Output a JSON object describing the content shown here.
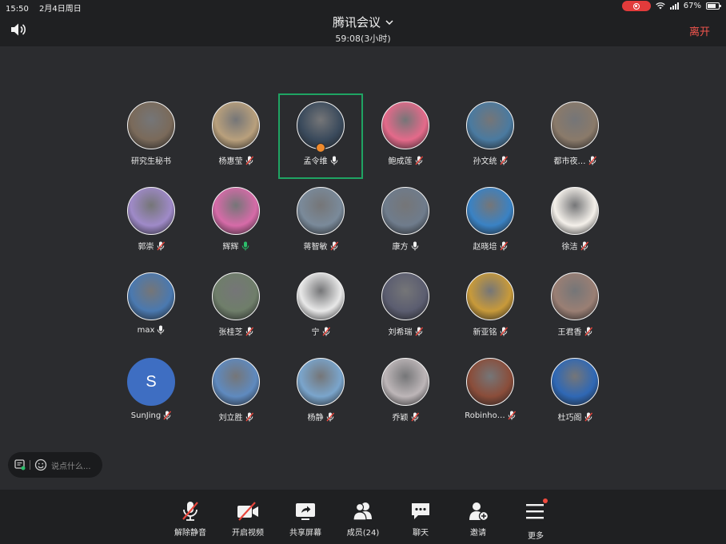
{
  "status_bar": {
    "time": "15:50",
    "date": "2月4日周日",
    "battery": "67%"
  },
  "meeting": {
    "title": "腾讯会议",
    "timer": "59:08(3小时)",
    "leave_label": "离开"
  },
  "participants": [
    {
      "name": "研究生秘书",
      "mic": "none",
      "bg": "#7a6a5a"
    },
    {
      "name": "杨惠莹",
      "mic": "muted",
      "bg": "#b9a07c"
    },
    {
      "name": "孟令维",
      "mic": "on",
      "bg": "#3a4a5c",
      "active": true,
      "host": true
    },
    {
      "name": "鲍成莲",
      "mic": "muted",
      "bg": "#e46a8a"
    },
    {
      "name": "孙文统",
      "mic": "muted",
      "bg": "#4a7aa0"
    },
    {
      "name": "都市夜…",
      "mic": "muted",
      "bg": "#8a7a6a"
    },
    {
      "name": "郭崇",
      "mic": "muted",
      "bg": "#9f8ac8"
    },
    {
      "name": "辉辉",
      "mic": "active",
      "bg": "#d66ba8"
    },
    {
      "name": "蒋智敏",
      "mic": "muted",
      "bg": "#7a8a9a"
    },
    {
      "name": "康方",
      "mic": "on",
      "bg": "#6f7c8c"
    },
    {
      "name": "赵晓培",
      "mic": "muted",
      "bg": "#3a82c4"
    },
    {
      "name": "徐洁",
      "mic": "muted",
      "bg": "#f4f0ea"
    },
    {
      "name": "max",
      "mic": "on",
      "bg": "#4a79b0"
    },
    {
      "name": "张桂芝",
      "mic": "muted",
      "bg": "#6f7e6a"
    },
    {
      "name": "宁",
      "mic": "muted",
      "bg": "#e8e8e8"
    },
    {
      "name": "刘希瑞",
      "mic": "muted",
      "bg": "#5b5d70"
    },
    {
      "name": "新亚铭",
      "mic": "muted",
      "bg": "#c89a3a"
    },
    {
      "name": "王君香",
      "mic": "muted",
      "bg": "#9a7f74"
    },
    {
      "name": "SunJing",
      "mic": "muted",
      "bg": "#3e6ec2",
      "letter": "S"
    },
    {
      "name": "刘立胜",
      "mic": "muted",
      "bg": "#5f8abf"
    },
    {
      "name": "杨静",
      "mic": "muted",
      "bg": "#7aa5cc"
    },
    {
      "name": "乔颖",
      "mic": "muted",
      "bg": "#bdb6b8"
    },
    {
      "name": "Robinho…",
      "mic": "muted",
      "bg": "#8a4d3a"
    },
    {
      "name": "杜巧阁",
      "mic": "muted",
      "bg": "#2f68b5"
    }
  ],
  "chat": {
    "placeholder": "说点什么..."
  },
  "toolbar": {
    "unmute": "解除静音",
    "video": "开启视频",
    "share": "共享屏幕",
    "members": "成员(24)",
    "chat": "聊天",
    "invite": "邀请",
    "more": "更多"
  }
}
